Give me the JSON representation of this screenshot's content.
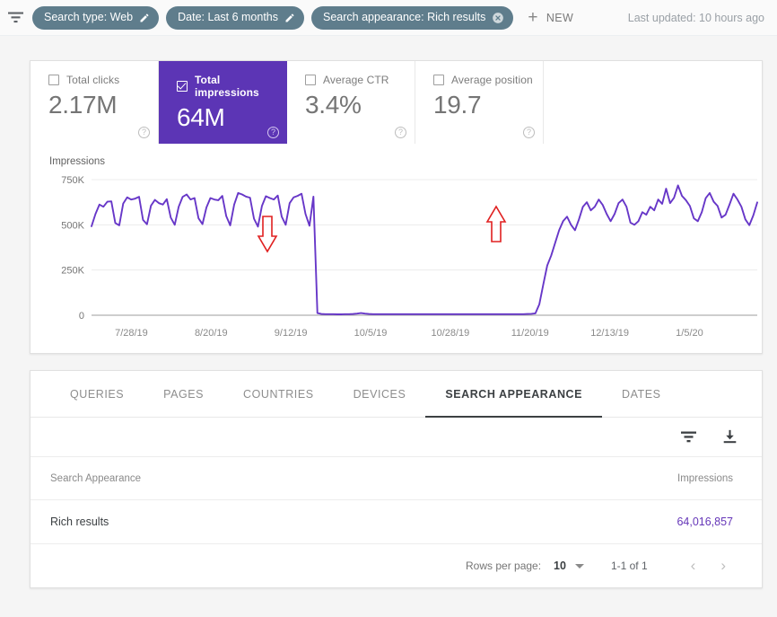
{
  "topbar": {
    "funnel_icon": "filter-icon",
    "chips": [
      {
        "label": "Search type: Web",
        "action_icon": "pencil-icon"
      },
      {
        "label": "Date: Last 6 months",
        "action_icon": "pencil-icon"
      },
      {
        "label": "Search appearance: Rich results",
        "action_icon": "close-circle-icon"
      }
    ],
    "new_label": "NEW",
    "plus_icon": "plus-icon",
    "last_updated": "Last updated: 10 hours ago"
  },
  "metrics": [
    {
      "label": "Total clicks",
      "value": "2.17M",
      "selected": false,
      "help_icon": "help-icon"
    },
    {
      "label": "Total impressions",
      "value": "64M",
      "selected": true,
      "help_icon": "help-icon"
    },
    {
      "label": "Average CTR",
      "value": "3.4%",
      "selected": false,
      "help_icon": "help-icon"
    },
    {
      "label": "Average position",
      "value": "19.7",
      "selected": false,
      "help_icon": "help-icon"
    }
  ],
  "colors": {
    "selected_card": "#5c35b5",
    "line": "#6737c8",
    "chip": "#5f7d8c",
    "annotation": "#e02020",
    "link_value": "#6536b8"
  },
  "chart_data": {
    "type": "line",
    "title": "Impressions",
    "xlabel": "",
    "ylabel": "Impressions",
    "ylim": [
      0,
      750000
    ],
    "ytick_labels": [
      "750K",
      "500K",
      "250K",
      "0"
    ],
    "ytick_values": [
      750000,
      500000,
      250000,
      0
    ],
    "xtick_labels": [
      "7/28/19",
      "8/20/19",
      "9/12/19",
      "10/5/19",
      "10/28/19",
      "11/20/19",
      "12/13/19",
      "1/5/20"
    ],
    "grid": true,
    "legend": "none",
    "series": [
      {
        "name": "Impressions",
        "color": "#6737c8",
        "values": [
          492000,
          560000,
          612000,
          600000,
          628000,
          630000,
          510000,
          497000,
          618000,
          652000,
          640000,
          645000,
          655000,
          527000,
          503000,
          606000,
          638000,
          620000,
          612000,
          642000,
          540000,
          500000,
          600000,
          655000,
          668000,
          640000,
          648000,
          536000,
          504000,
          596000,
          648000,
          640000,
          636000,
          660000,
          548000,
          497000,
          612000,
          676000,
          668000,
          656000,
          650000,
          534000,
          490000,
          604000,
          658000,
          648000,
          640000,
          662000,
          545000,
          500000,
          620000,
          652000,
          660000,
          672000,
          560000,
          495000,
          656000,
          12000,
          7000,
          6000,
          6000,
          6000,
          5000,
          5000,
          6000,
          6000,
          7000,
          9000,
          12000,
          9000,
          7000,
          6000,
          6000,
          6000,
          6000,
          6000,
          6000,
          6000,
          6000,
          6000,
          6000,
          6000,
          6000,
          6000,
          6000,
          6000,
          6000,
          6000,
          6000,
          6000,
          6000,
          6000,
          6000,
          6000,
          6000,
          6000,
          6000,
          6000,
          6000,
          6000,
          6000,
          6000,
          6000,
          6000,
          6000,
          6000,
          6000,
          6000,
          6000,
          6000,
          7000,
          8000,
          10000,
          60000,
          170000,
          275000,
          330000,
          400000,
          470000,
          520000,
          545000,
          500000,
          470000,
          530000,
          600000,
          625000,
          580000,
          600000,
          640000,
          610000,
          560000,
          520000,
          560000,
          620000,
          640000,
          600000,
          512000,
          500000,
          520000,
          570000,
          556000,
          600000,
          580000,
          640000,
          616000,
          700000,
          620000,
          650000,
          718000,
          660000,
          636000,
          604000,
          536000,
          520000,
          570000,
          648000,
          676000,
          628000,
          604000,
          540000,
          556000,
          612000,
          672000,
          640000,
          600000,
          530000,
          498000,
          552000,
          624000
        ]
      }
    ],
    "annotations": [
      {
        "name": "drop-arrow",
        "direction": "down",
        "label": "",
        "color": "#e02020"
      },
      {
        "name": "recovery-arrow",
        "direction": "up",
        "label": "",
        "color": "#e02020"
      }
    ]
  },
  "details": {
    "tabs": [
      {
        "label": "QUERIES",
        "active": false
      },
      {
        "label": "PAGES",
        "active": false
      },
      {
        "label": "COUNTRIES",
        "active": false
      },
      {
        "label": "DEVICES",
        "active": false
      },
      {
        "label": "SEARCH APPEARANCE",
        "active": true
      },
      {
        "label": "DATES",
        "active": false
      }
    ],
    "tools": [
      {
        "icon": "filter-icon"
      },
      {
        "icon": "download-icon"
      }
    ],
    "table": {
      "columns": [
        "Search Appearance",
        "Impressions"
      ],
      "rows": [
        {
          "name": "Rich results",
          "impressions": "64,016,857"
        }
      ]
    },
    "pager": {
      "rows_per_page_label": "Rows per page:",
      "rows_per_page_value": "10",
      "dropdown_icon": "chevron-down-icon",
      "range": "1-1 of 1",
      "prev_icon": "chevron-left-icon",
      "next_icon": "chevron-right-icon"
    }
  }
}
